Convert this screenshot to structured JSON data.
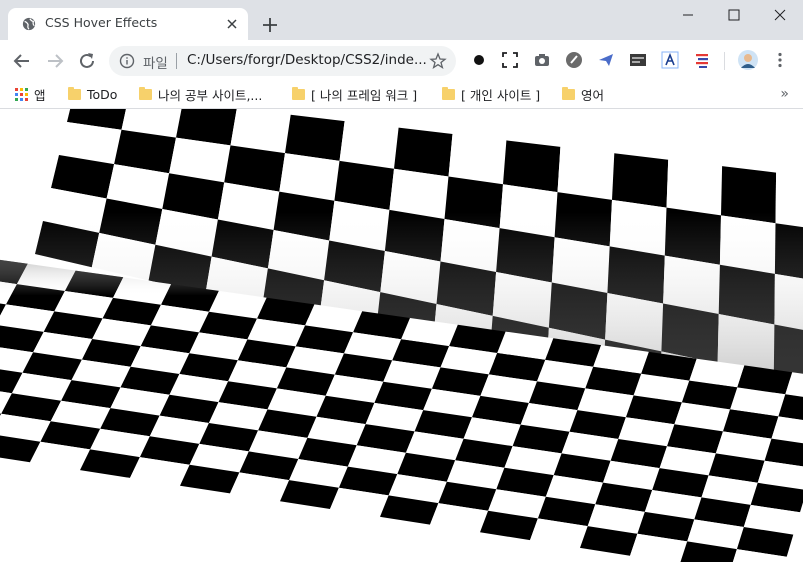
{
  "tab": {
    "title": "CSS Hover Effects",
    "icon": "globe-icon"
  },
  "address_bar": {
    "scheme_label": "파일",
    "url": "C:/Users/forgr/Desktop/CSS2/inde..."
  },
  "bookmarks": {
    "apps_label": "앱",
    "items": [
      "ToDo",
      "나의 공부 사이트,...",
      "[ 나의 프레임 워크 ]",
      "[ 개인 사이트 ]",
      "영어"
    ],
    "more": "»"
  },
  "colors": {
    "titlebar": "#dee1e6",
    "omnibox": "#f1f3f4",
    "folder": "#f7d16b"
  },
  "scene": {
    "description_pattern": "checkerboard",
    "tile_colors": [
      "#000000",
      "#ffffff"
    ]
  }
}
